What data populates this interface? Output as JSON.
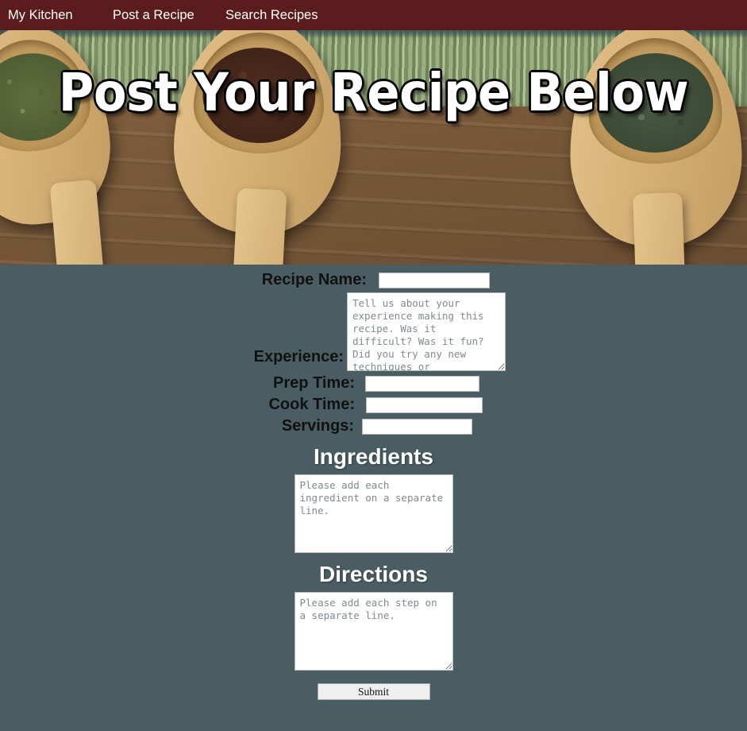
{
  "nav": {
    "items": [
      {
        "label": "My Kitchen"
      },
      {
        "label": "Post a Recipe"
      },
      {
        "label": "Search Recipes"
      }
    ],
    "background_color": "#5a1c1c",
    "text_color": "#ffffff"
  },
  "hero": {
    "title": "Post Your Recipe Below",
    "image_description": "three wooden spoons holding dried herbs, cloves and thyme on a wooden table with a green bamboo mat"
  },
  "page": {
    "background_color": "#4a5d63"
  },
  "form": {
    "recipe_name": {
      "label": "Recipe Name:",
      "value": "",
      "placeholder": ""
    },
    "experience": {
      "label": "Experience:",
      "value": "",
      "placeholder": "Tell us about your experience making this recipe. Was it difficult? Was it fun? Did you try any new techniques or ingredients not normally associated with this cuisine?"
    },
    "prep_time": {
      "label": "Prep Time:",
      "value": "",
      "placeholder": ""
    },
    "cook_time": {
      "label": "Cook Time:",
      "value": "",
      "placeholder": ""
    },
    "servings": {
      "label": "Servings:",
      "value": "",
      "placeholder": ""
    },
    "ingredients": {
      "heading": "Ingredients",
      "value": "",
      "placeholder": "Please add each ingredient on a separate line."
    },
    "directions": {
      "heading": "Directions",
      "value": "",
      "placeholder": "Please add each step on a separate line."
    },
    "submit": {
      "label": "Submit"
    }
  }
}
